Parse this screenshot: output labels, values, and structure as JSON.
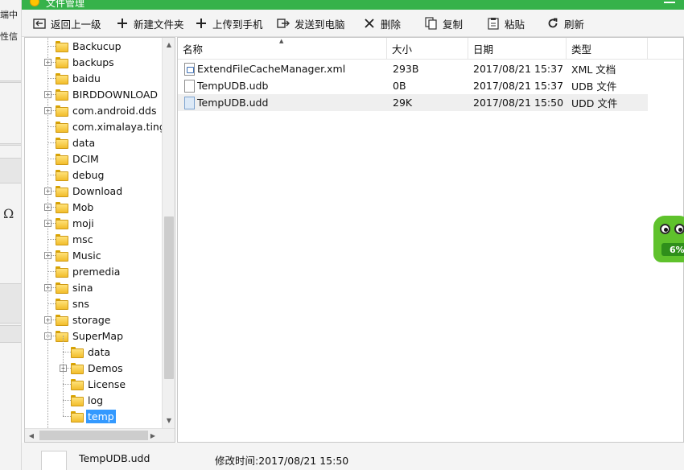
{
  "window": {
    "title": "文件管理"
  },
  "background": {
    "lines": [
      "端中",
      "性信"
    ]
  },
  "toolbar": {
    "items": [
      {
        "label": "返回上一级",
        "icon": "back-icon"
      },
      {
        "label": "新建文件夹",
        "icon": "plus-icon"
      },
      {
        "label": "上传到手机",
        "icon": "plus-icon"
      },
      {
        "label": "发送到电脑",
        "icon": "send-icon"
      },
      {
        "label": "删除",
        "icon": "close-icon"
      },
      {
        "label": "复制",
        "icon": "copy-icon"
      },
      {
        "label": "粘贴",
        "icon": "paste-icon"
      },
      {
        "label": "刷新",
        "icon": "refresh-icon"
      }
    ]
  },
  "tree": {
    "items": [
      {
        "label": "Backucup",
        "expandable": false,
        "level": 0
      },
      {
        "label": "backups",
        "expandable": true,
        "level": 0
      },
      {
        "label": "baidu",
        "expandable": false,
        "level": 0
      },
      {
        "label": "BIRDDOWNLOAD",
        "expandable": true,
        "level": 0
      },
      {
        "label": "com.android.dds",
        "expandable": true,
        "level": 0
      },
      {
        "label": "com.ximalaya.ting.",
        "expandable": false,
        "level": 0
      },
      {
        "label": "data",
        "expandable": false,
        "level": 0
      },
      {
        "label": "DCIM",
        "expandable": false,
        "level": 0
      },
      {
        "label": "debug",
        "expandable": false,
        "level": 0
      },
      {
        "label": "Download",
        "expandable": true,
        "level": 0
      },
      {
        "label": "Mob",
        "expandable": true,
        "level": 0
      },
      {
        "label": "moji",
        "expandable": true,
        "level": 0
      },
      {
        "label": "msc",
        "expandable": false,
        "level": 0
      },
      {
        "label": "Music",
        "expandable": true,
        "level": 0
      },
      {
        "label": "premedia",
        "expandable": false,
        "level": 0
      },
      {
        "label": "sina",
        "expandable": true,
        "level": 0
      },
      {
        "label": "sns",
        "expandable": false,
        "level": 0
      },
      {
        "label": "storage",
        "expandable": true,
        "level": 0
      },
      {
        "label": "SuperMap",
        "expandable": true,
        "expanded": true,
        "level": 0
      },
      {
        "label": "data",
        "expandable": false,
        "level": 1
      },
      {
        "label": "Demos",
        "expandable": true,
        "level": 1
      },
      {
        "label": "License",
        "expandable": false,
        "level": 1
      },
      {
        "label": "log",
        "expandable": false,
        "level": 1
      },
      {
        "label": "temp",
        "expandable": false,
        "level": 1,
        "selected": true
      }
    ]
  },
  "list": {
    "columns": [
      "名称",
      "大小",
      "日期",
      "类型"
    ],
    "rows": [
      {
        "name": "ExtendFileCacheManager.xml",
        "size": "293B",
        "date": "2017/08/21 15:37",
        "type": "XML 文档",
        "icon": "xml"
      },
      {
        "name": "TempUDB.udb",
        "size": "0B",
        "date": "2017/08/21 15:37",
        "type": "UDB 文件",
        "icon": "udb"
      },
      {
        "name": "TempUDB.udd",
        "size": "29K",
        "date": "2017/08/21 15:50",
        "type": "UDD 文件",
        "icon": "udd",
        "highlighted": true
      }
    ]
  },
  "status": {
    "filename": "TempUDB.udd",
    "modified": "修改时间:2017/08/21 15:50"
  },
  "mascot": {
    "percent": "6%"
  },
  "colors": {
    "titlebar": "#36b24a",
    "selection": "#3399ff",
    "mascot": "#5fc22c"
  }
}
